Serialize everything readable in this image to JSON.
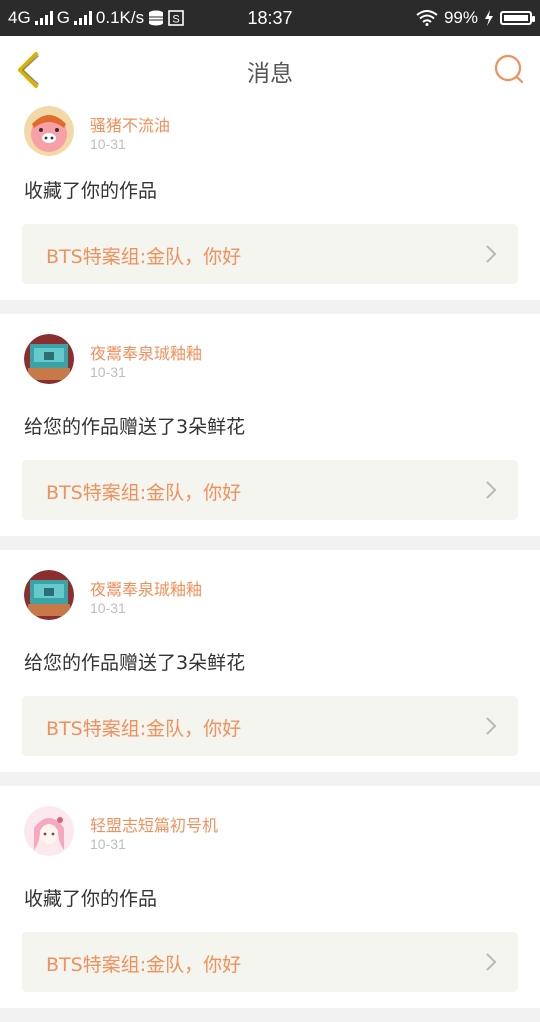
{
  "status_bar": {
    "network": "4G",
    "signal2": "G",
    "speed": "0.1K/s",
    "time": "18:37",
    "battery": "99%"
  },
  "nav": {
    "title": "消息"
  },
  "messages": [
    {
      "username": "骚猪不流油",
      "date": "10-31",
      "action": "收藏了你的作品",
      "work_title": "BTS特案组:金队，你好",
      "avatar_icon": "cartoon-pig-avatar"
    },
    {
      "username": "夜鬻奉泉珹釉釉",
      "date": "10-31",
      "action": "给您的作品赠送了3朵鲜花",
      "work_title": "BTS特案组:金队，你好",
      "avatar_icon": "teal-photo-avatar"
    },
    {
      "username": "夜鬻奉泉珹釉釉",
      "date": "10-31",
      "action": "给您的作品赠送了3朵鲜花",
      "work_title": "BTS特案组:金队，你好",
      "avatar_icon": "teal-photo-avatar"
    },
    {
      "username": "轻盟志短篇初号机",
      "date": "10-31",
      "action": "收藏了你的作品",
      "work_title": "BTS特案组:金队，你好",
      "avatar_icon": "anime-girl-avatar"
    }
  ],
  "colors": {
    "accent": "#f0905b",
    "back_arrow": "#d8b400",
    "statusbar": "#2b2b2b"
  }
}
